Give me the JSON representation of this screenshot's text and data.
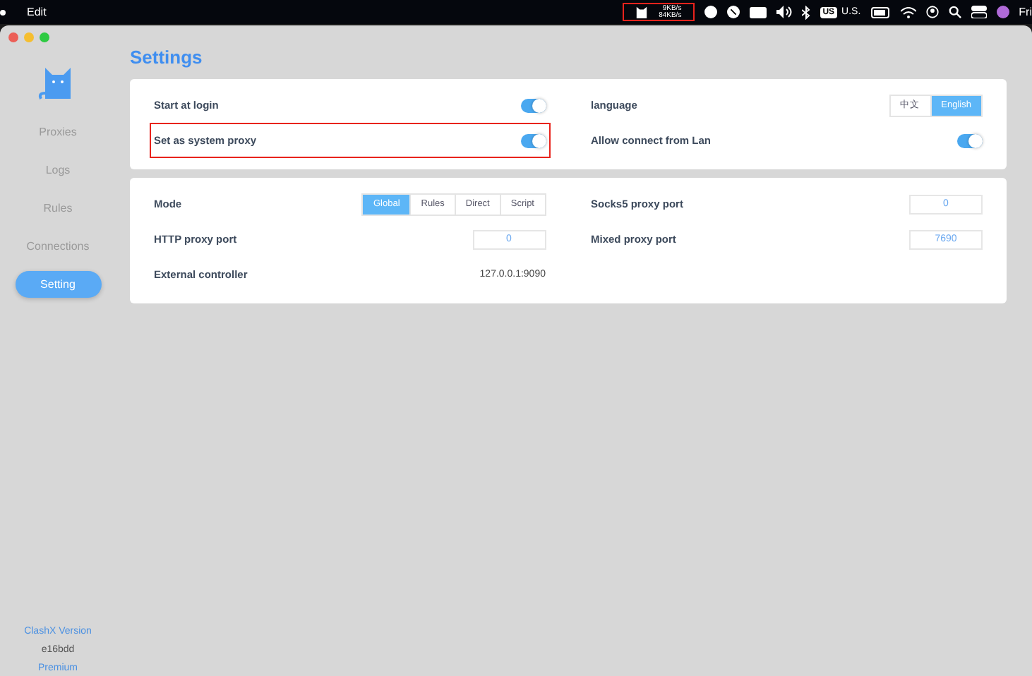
{
  "menu_bar": {
    "menus": [
      "Edit"
    ],
    "net_speed": {
      "upload": "9KB/s",
      "download": "84KB/s",
      "highlighted": true
    },
    "input_source": {
      "badge": "US",
      "label": "U.S."
    },
    "clock": "Fri"
  },
  "sidebar": {
    "items": [
      {
        "label": "Proxies",
        "selected": false
      },
      {
        "label": "Logs",
        "selected": false
      },
      {
        "label": "Rules",
        "selected": false
      },
      {
        "label": "Connections",
        "selected": false
      },
      {
        "label": "Setting",
        "selected": true
      }
    ],
    "version_label": "ClashX Version",
    "version": "e16bdd",
    "edition": "Premium"
  },
  "title": "Settings",
  "cards": [
    {
      "left": [
        {
          "kind": "toggle",
          "label": "Start at login",
          "on": true,
          "highlighted": false
        },
        {
          "kind": "toggle",
          "label": "Set as system proxy",
          "on": true,
          "highlighted": true
        }
      ],
      "right": [
        {
          "kind": "segmented",
          "label": "language",
          "options": [
            {
              "label": "中文",
              "selected": false
            },
            {
              "label": "English",
              "selected": true
            }
          ]
        },
        {
          "kind": "toggle",
          "label": "Allow connect from Lan",
          "on": true,
          "highlighted": false
        }
      ]
    },
    {
      "left": [
        {
          "kind": "segmented",
          "label": "Mode",
          "options": [
            {
              "label": "Global",
              "selected": true
            },
            {
              "label": "Rules",
              "selected": false
            },
            {
              "label": "Direct",
              "selected": false
            },
            {
              "label": "Script",
              "selected": false
            }
          ]
        },
        {
          "kind": "input",
          "label": "HTTP proxy port",
          "value": "0"
        },
        {
          "kind": "text",
          "label": "External controller",
          "value": "127.0.0.1:9090"
        }
      ],
      "right": [
        {
          "kind": "input",
          "label": "Socks5 proxy port",
          "value": "0"
        },
        {
          "kind": "input",
          "label": "Mixed proxy port",
          "value": "7690"
        }
      ]
    }
  ]
}
